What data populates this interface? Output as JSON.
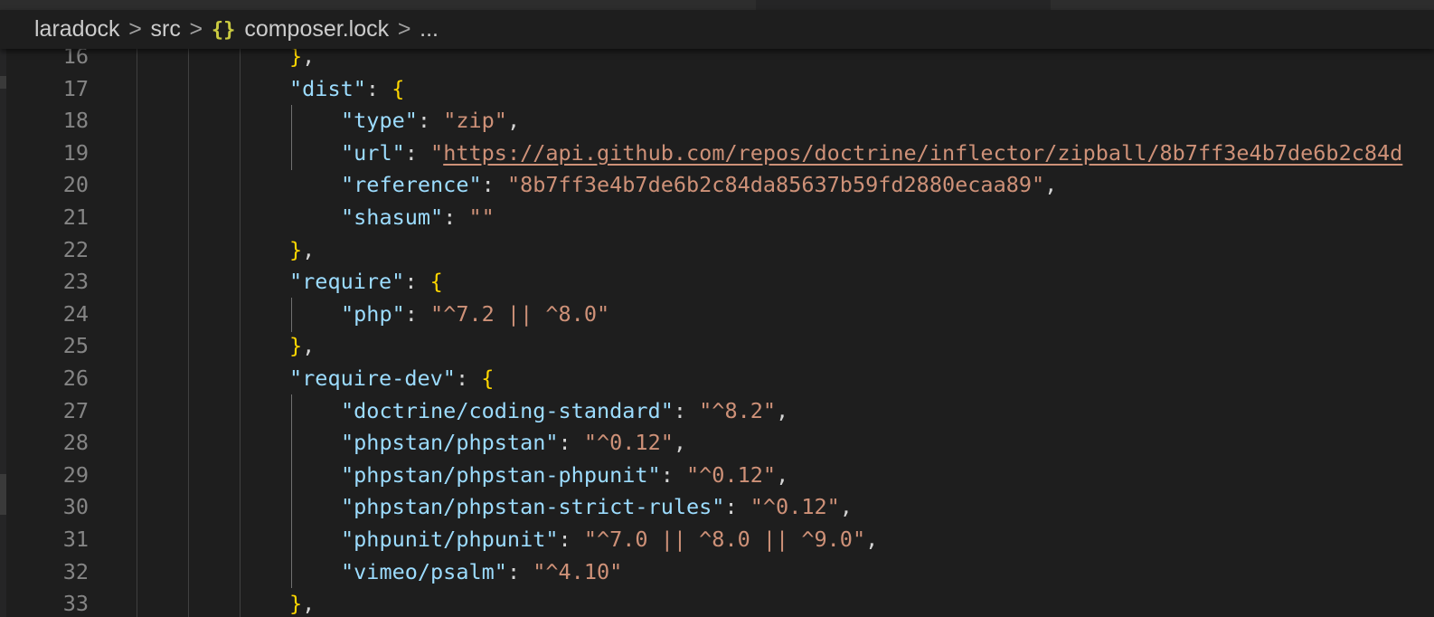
{
  "breadcrumb": {
    "items": [
      "laradock",
      "src",
      "composer.lock",
      "..."
    ],
    "separator": ">",
    "file_icon": "{}"
  },
  "editor": {
    "lines": [
      {
        "n": "16",
        "indent": 0,
        "toks": [
          [
            "b",
            "}"
          ],
          [
            "p",
            ","
          ]
        ]
      },
      {
        "n": "17",
        "indent": 0,
        "toks": [
          [
            "k",
            "\"dist\""
          ],
          [
            "p",
            ": "
          ],
          [
            "b",
            "{"
          ]
        ]
      },
      {
        "n": "18",
        "indent": 1,
        "toks": [
          [
            "k",
            "\"type\""
          ],
          [
            "p",
            ": "
          ],
          [
            "s",
            "\"zip\""
          ],
          [
            "p",
            ","
          ]
        ]
      },
      {
        "n": "19",
        "indent": 1,
        "toks": [
          [
            "k",
            "\"url\""
          ],
          [
            "p",
            ": "
          ],
          [
            "s",
            "\""
          ],
          [
            "u",
            "https://api.github.com/repos/doctrine/inflector/zipball/8b7ff3e4b7de6b2c84d"
          ]
        ]
      },
      {
        "n": "20",
        "indent": 1,
        "toks": [
          [
            "k",
            "\"reference\""
          ],
          [
            "p",
            ": "
          ],
          [
            "s",
            "\"8b7ff3e4b7de6b2c84da85637b59fd2880ecaa89\""
          ],
          [
            "p",
            ","
          ]
        ]
      },
      {
        "n": "21",
        "indent": 1,
        "toks": [
          [
            "k",
            "\"shasum\""
          ],
          [
            "p",
            ": "
          ],
          [
            "s",
            "\"\""
          ]
        ]
      },
      {
        "n": "22",
        "indent": 0,
        "toks": [
          [
            "b",
            "}"
          ],
          [
            "p",
            ","
          ]
        ]
      },
      {
        "n": "23",
        "indent": 0,
        "toks": [
          [
            "k",
            "\"require\""
          ],
          [
            "p",
            ": "
          ],
          [
            "b",
            "{"
          ]
        ]
      },
      {
        "n": "24",
        "indent": 1,
        "toks": [
          [
            "k",
            "\"php\""
          ],
          [
            "p",
            ": "
          ],
          [
            "s",
            "\"^7.2 || ^8.0\""
          ]
        ]
      },
      {
        "n": "25",
        "indent": 0,
        "toks": [
          [
            "b",
            "}"
          ],
          [
            "p",
            ","
          ]
        ]
      },
      {
        "n": "26",
        "indent": 0,
        "toks": [
          [
            "k",
            "\"require-dev\""
          ],
          [
            "p",
            ": "
          ],
          [
            "b",
            "{"
          ]
        ]
      },
      {
        "n": "27",
        "indent": 1,
        "toks": [
          [
            "k",
            "\"doctrine/coding-standard\""
          ],
          [
            "p",
            ": "
          ],
          [
            "s",
            "\"^8.2\""
          ],
          [
            "p",
            ","
          ]
        ]
      },
      {
        "n": "28",
        "indent": 1,
        "toks": [
          [
            "k",
            "\"phpstan/phpstan\""
          ],
          [
            "p",
            ": "
          ],
          [
            "s",
            "\"^0.12\""
          ],
          [
            "p",
            ","
          ]
        ]
      },
      {
        "n": "29",
        "indent": 1,
        "toks": [
          [
            "k",
            "\"phpstan/phpstan-phpunit\""
          ],
          [
            "p",
            ": "
          ],
          [
            "s",
            "\"^0.12\""
          ],
          [
            "p",
            ","
          ]
        ]
      },
      {
        "n": "30",
        "indent": 1,
        "toks": [
          [
            "k",
            "\"phpstan/phpstan-strict-rules\""
          ],
          [
            "p",
            ": "
          ],
          [
            "s",
            "\"^0.12\""
          ],
          [
            "p",
            ","
          ]
        ]
      },
      {
        "n": "31",
        "indent": 1,
        "toks": [
          [
            "k",
            "\"phpunit/phpunit\""
          ],
          [
            "p",
            ": "
          ],
          [
            "s",
            "\"^7.0 || ^8.0 || ^9.0\""
          ],
          [
            "p",
            ","
          ]
        ]
      },
      {
        "n": "32",
        "indent": 1,
        "toks": [
          [
            "k",
            "\"vimeo/psalm\""
          ],
          [
            "p",
            ": "
          ],
          [
            "s",
            "\"^4.10\""
          ]
        ]
      },
      {
        "n": "33",
        "indent": 0,
        "toks": [
          [
            "b",
            "}"
          ],
          [
            "p",
            ","
          ]
        ]
      }
    ]
  },
  "colors": {
    "background": "#1e1e1e",
    "key": "#9cdcfe",
    "string": "#ce9178",
    "bracket": "#ffd700",
    "punctuation": "#d4d4d4",
    "line_number": "#858585",
    "breadcrumb_text": "#cccccc",
    "json_icon": "#cbcb41"
  }
}
